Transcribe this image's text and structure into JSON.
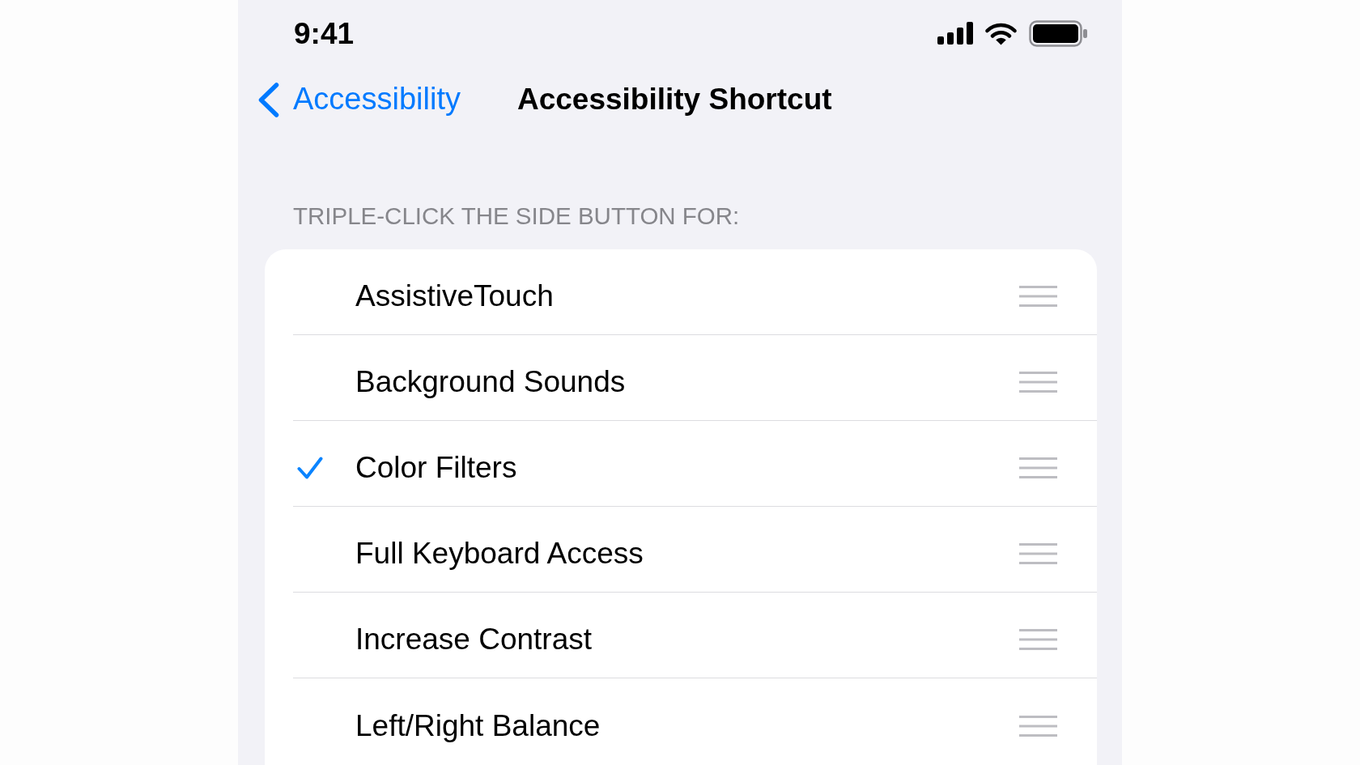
{
  "status_bar": {
    "time": "9:41"
  },
  "nav_bar": {
    "back_label": "Accessibility",
    "title": "Accessibility Shortcut"
  },
  "shortcut_list": {
    "header": "TRIPLE-CLICK THE SIDE BUTTON FOR:",
    "items": [
      {
        "label": "AssistiveTouch",
        "selected": false
      },
      {
        "label": "Background Sounds",
        "selected": false
      },
      {
        "label": "Color Filters",
        "selected": true
      },
      {
        "label": "Full Keyboard Access",
        "selected": false
      },
      {
        "label": "Increase Contrast",
        "selected": false
      },
      {
        "label": "Left/Right Balance",
        "selected": false
      }
    ]
  }
}
